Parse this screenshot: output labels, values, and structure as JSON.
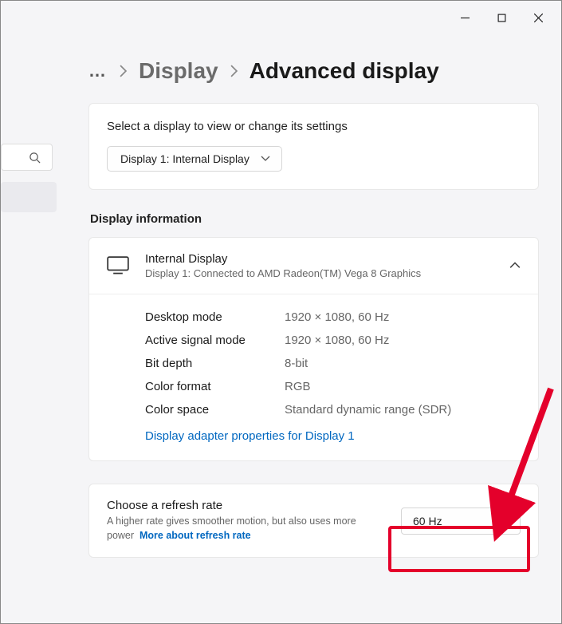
{
  "titlebar": {
    "minimize": "minimize",
    "maximize": "maximize",
    "close": "close"
  },
  "breadcrumb": {
    "parent": "Display",
    "current": "Advanced display"
  },
  "select_display": {
    "prompt": "Select a display to view or change its settings",
    "value": "Display 1: Internal Display"
  },
  "info_section": {
    "heading": "Display information",
    "title": "Internal Display",
    "subtitle": "Display 1: Connected to AMD Radeon(TM) Vega 8 Graphics",
    "rows": [
      {
        "label": "Desktop mode",
        "value": "1920 × 1080, 60 Hz"
      },
      {
        "label": "Active signal mode",
        "value": "1920 × 1080, 60 Hz"
      },
      {
        "label": "Bit depth",
        "value": "8-bit"
      },
      {
        "label": "Color format",
        "value": "RGB"
      },
      {
        "label": "Color space",
        "value": "Standard dynamic range (SDR)"
      }
    ],
    "adapter_link": "Display adapter properties for Display 1"
  },
  "refresh": {
    "title": "Choose a refresh rate",
    "desc": "A higher rate gives smoother motion, but also uses more power",
    "link": "More about refresh rate",
    "value": "60 Hz"
  }
}
